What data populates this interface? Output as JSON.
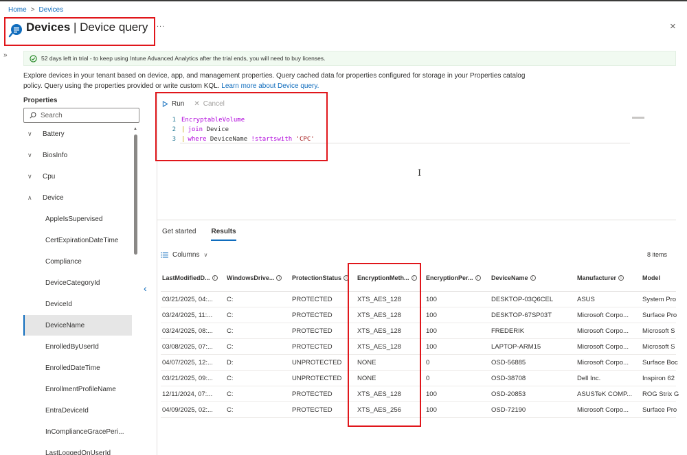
{
  "breadcrumb": {
    "home": "Home",
    "current": "Devices",
    "separator": ">"
  },
  "header": {
    "title_bold": "Devices",
    "title_rest": " | Device query",
    "more": "...",
    "close": "×"
  },
  "banner": {
    "text": "52 days left in trial - to keep using Intune Advanced Analytics after the trial ends, you will need to buy licenses."
  },
  "description": {
    "text": "Explore devices in your tenant based on device, app, and management properties. Query cached data for properties configured for storage in your Properties catalog policy. Query using the properties provided or write custom KQL.",
    "link": "Learn more about Device query."
  },
  "properties": {
    "label": "Properties",
    "search_placeholder": "Search",
    "items": [
      {
        "label": "Battery",
        "chevron": "∨"
      },
      {
        "label": "BiosInfo",
        "chevron": "∨"
      },
      {
        "label": "Cpu",
        "chevron": "∨"
      },
      {
        "label": "Device",
        "chevron": "∧"
      },
      {
        "label": "AppleIsSupervised"
      },
      {
        "label": "CertExpirationDateTime"
      },
      {
        "label": "Compliance"
      },
      {
        "label": "DeviceCategoryId"
      },
      {
        "label": "DeviceId"
      },
      {
        "label": "DeviceName"
      },
      {
        "label": "EnrolledByUserId"
      },
      {
        "label": "EnrolledDateTime"
      },
      {
        "label": "EnrollmentProfileName"
      },
      {
        "label": "EntraDeviceId"
      },
      {
        "label": "InComplianceGracePeri..."
      },
      {
        "label": "LastLoggedOnUserId"
      }
    ]
  },
  "toolbar": {
    "run": "Run",
    "cancel": "Cancel"
  },
  "query": {
    "lines": [
      {
        "n": "1",
        "text": "EncryptableVolume"
      },
      {
        "n": "2",
        "pipe": "|",
        "kw": "join",
        "rest": " Device"
      },
      {
        "n": "3",
        "pipe": "|",
        "kw": "where",
        "rest": " DeviceName ",
        "op": "!startswith",
        "str": " 'CPC'"
      }
    ]
  },
  "results_tabs": {
    "get_started": "Get started",
    "results": "Results"
  },
  "results": {
    "columns_label": "Columns",
    "count": "8 items",
    "headers": [
      "LastModifiedD...",
      "WindowsDrive...",
      "ProtectionStatus",
      "EncryptionMeth...",
      "EncryptionPer...",
      "DeviceName",
      "Manufacturer",
      "Model"
    ],
    "rows": [
      [
        "03/21/2025, 04:...",
        "C:",
        "PROTECTED",
        "XTS_AES_128",
        "100",
        "DESKTOP-03Q6CEL",
        "ASUS",
        "System Pro"
      ],
      [
        "03/24/2025, 11:...",
        "C:",
        "PROTECTED",
        "XTS_AES_128",
        "100",
        "DESKTOP-67SP03T",
        "Microsoft Corpo...",
        "Surface Pro"
      ],
      [
        "03/24/2025, 08:...",
        "C:",
        "PROTECTED",
        "XTS_AES_128",
        "100",
        "FREDERIK",
        "Microsoft Corpo...",
        "Microsoft S"
      ],
      [
        "03/08/2025, 07:...",
        "C:",
        "PROTECTED",
        "XTS_AES_128",
        "100",
        "LAPTOP-ARM15",
        "Microsoft Corpo...",
        "Microsoft S"
      ],
      [
        "04/07/2025, 12:...",
        "D:",
        "UNPROTECTED",
        "NONE",
        "0",
        "OSD-56885",
        "Microsoft Corpo...",
        "Surface Boc"
      ],
      [
        "03/21/2025, 09:...",
        "C:",
        "UNPROTECTED",
        "NONE",
        "0",
        "OSD-38708",
        "Dell Inc.",
        "Inspiron 62"
      ],
      [
        "12/11/2024, 07:...",
        "C:",
        "PROTECTED",
        "XTS_AES_128",
        "100",
        "OSD-20853",
        "ASUSTeK COMP...",
        "ROG Strix G"
      ],
      [
        "04/09/2025, 02:...",
        "C:",
        "PROTECTED",
        "XTS_AES_256",
        "100",
        "OSD-72190",
        "Microsoft Corpo...",
        "Surface Pro"
      ]
    ]
  },
  "colors": {
    "accent": "#0f6cbd",
    "highlight_box": "#e0161b",
    "banner_bg": "#f1faf1"
  }
}
